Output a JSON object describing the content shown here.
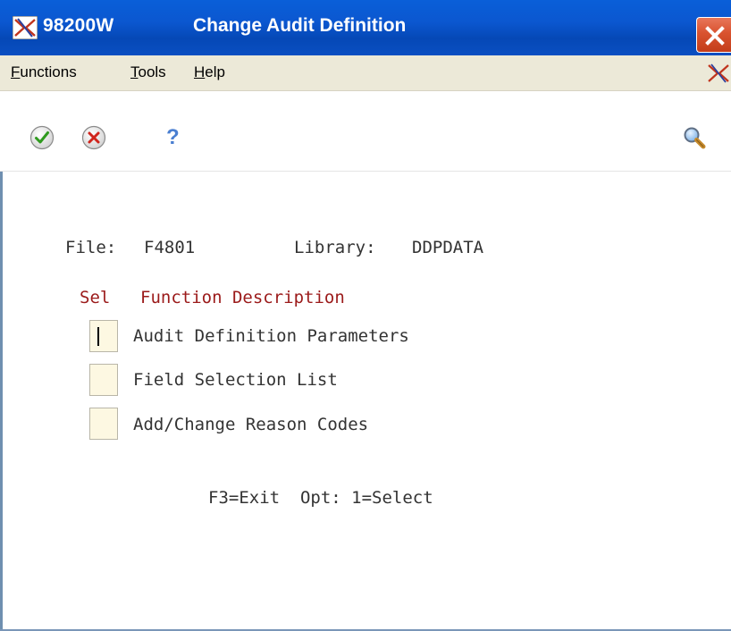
{
  "window": {
    "program_id": "98200W",
    "title": "Change Audit Definition"
  },
  "menu": {
    "items": [
      {
        "label": "Functions",
        "mnemonic": "F"
      },
      {
        "label": "Tools",
        "mnemonic": "T"
      },
      {
        "label": "Help",
        "mnemonic": "H"
      }
    ]
  },
  "toolbar": {
    "help_glyph": "?"
  },
  "form": {
    "file_label": "File:",
    "file_value": "F4801",
    "library_label": "Library:",
    "library_value": "DDPDATA",
    "sel_header": "Sel",
    "desc_header": "Function Description",
    "options": [
      {
        "value": "",
        "description": "Audit Definition Parameters"
      },
      {
        "value": "",
        "description": "Field Selection List"
      },
      {
        "value": "",
        "description": "Add/Change Reason Codes"
      }
    ],
    "footer": "F3=Exit  Opt: 1=Select"
  },
  "colors": {
    "titlebar": "#0b57d0",
    "menubar": "#ece9d8",
    "header_text": "#9b1a1a",
    "input_bg": "#fdf8e2",
    "close_button": "#d9532f"
  }
}
